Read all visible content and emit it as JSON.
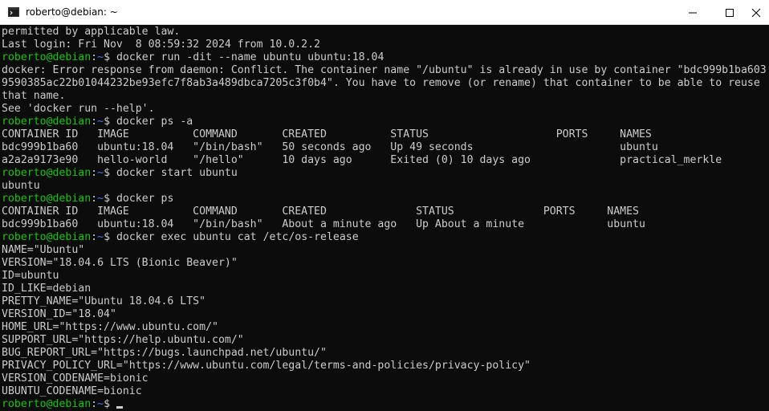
{
  "window": {
    "title": "roberto@debian: ~",
    "minimize_icon": "minimize-icon",
    "maximize_icon": "maximize-icon",
    "close_icon": "close-icon",
    "app_icon": "terminal-app-icon"
  },
  "prompt": {
    "user": "roberto@debian",
    "sep": ":",
    "path": "~",
    "symbol": "$ "
  },
  "lines": [
    {
      "kind": "out",
      "text": "permitted by applicable law."
    },
    {
      "kind": "out",
      "text": "Last login: Fri Nov  8 08:59:32 2024 from 10.0.2.2"
    },
    {
      "kind": "cmd",
      "text": "docker run -dit --name ubuntu ubuntu:18.04"
    },
    {
      "kind": "out",
      "text": "docker: Error response from daemon: Conflict. The container name \"/ubuntu\" is already in use by container \"bdc999b1ba603"
    },
    {
      "kind": "out",
      "text": "9590385ac22b01044232be93efc7f8ab3a489dbca7205c3f0b4\". You have to remove (or rename) that container to be able to reuse"
    },
    {
      "kind": "out",
      "text": "that name."
    },
    {
      "kind": "out",
      "text": "See 'docker run --help'."
    },
    {
      "kind": "cmd",
      "text": "docker ps -a"
    },
    {
      "kind": "out",
      "text": "CONTAINER ID   IMAGE          COMMAND       CREATED          STATUS                    PORTS     NAMES"
    },
    {
      "kind": "out",
      "text": "bdc999b1ba60   ubuntu:18.04   \"/bin/bash\"   50 seconds ago   Up 49 seconds                       ubuntu"
    },
    {
      "kind": "out",
      "text": "a2a2a9173e90   hello-world    \"/hello\"      10 days ago      Exited (0) 10 days ago              practical_merkle"
    },
    {
      "kind": "cmd",
      "text": "docker start ubuntu"
    },
    {
      "kind": "out",
      "text": "ubuntu"
    },
    {
      "kind": "cmd",
      "text": "docker ps"
    },
    {
      "kind": "out",
      "text": "CONTAINER ID   IMAGE          COMMAND       CREATED              STATUS              PORTS     NAMES"
    },
    {
      "kind": "out",
      "text": "bdc999b1ba60   ubuntu:18.04   \"/bin/bash\"   About a minute ago   Up About a minute             ubuntu"
    },
    {
      "kind": "cmd",
      "text": "docker exec ubuntu cat /etc/os-release"
    },
    {
      "kind": "out",
      "text": "NAME=\"Ubuntu\""
    },
    {
      "kind": "out",
      "text": "VERSION=\"18.04.6 LTS (Bionic Beaver)\""
    },
    {
      "kind": "out",
      "text": "ID=ubuntu"
    },
    {
      "kind": "out",
      "text": "ID_LIKE=debian"
    },
    {
      "kind": "out",
      "text": "PRETTY_NAME=\"Ubuntu 18.04.6 LTS\""
    },
    {
      "kind": "out",
      "text": "VERSION_ID=\"18.04\""
    },
    {
      "kind": "out",
      "text": "HOME_URL=\"https://www.ubuntu.com/\""
    },
    {
      "kind": "out",
      "text": "SUPPORT_URL=\"https://help.ubuntu.com/\""
    },
    {
      "kind": "out",
      "text": "BUG_REPORT_URL=\"https://bugs.launchpad.net/ubuntu/\""
    },
    {
      "kind": "out",
      "text": "PRIVACY_POLICY_URL=\"https://www.ubuntu.com/legal/terms-and-policies/privacy-policy\""
    },
    {
      "kind": "out",
      "text": "VERSION_CODENAME=bionic"
    },
    {
      "kind": "out",
      "text": "UBUNTU_CODENAME=bionic"
    },
    {
      "kind": "cmd",
      "text": ""
    }
  ],
  "colors": {
    "background": "#0c0c0c",
    "foreground": "#cccccc",
    "prompt_user": "#16c60c",
    "prompt_path": "#3b78ff",
    "titlebar": "#ffffff"
  }
}
